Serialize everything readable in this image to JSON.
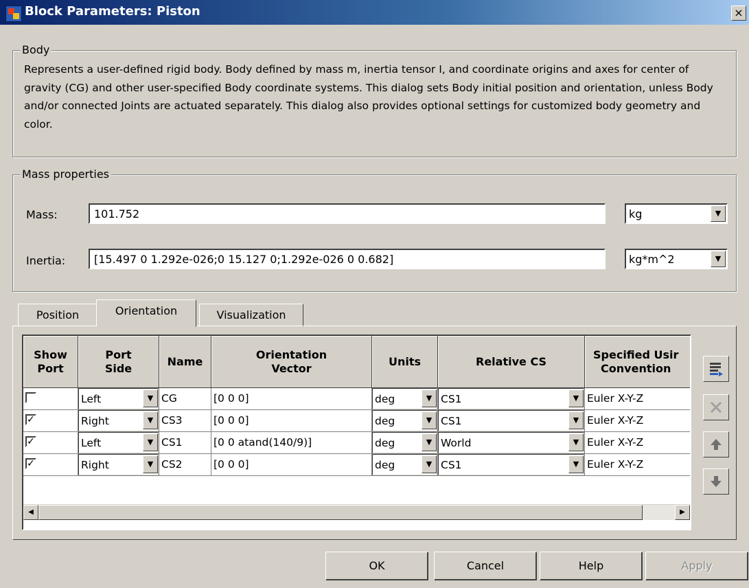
{
  "window": {
    "title": "Block Parameters: Piston",
    "close_label": "×"
  },
  "body_group": {
    "legend": "Body",
    "description": "Represents a user-defined rigid body. Body defined by mass m, inertia tensor I, and coordinate origins and axes for center of gravity (CG) and other user-specified Body coordinate systems. This dialog sets Body initial position and orientation, unless Body and/or connected Joints are actuated separately. This dialog also provides optional settings for customized body geometry and color."
  },
  "mass_group": {
    "legend": "Mass properties",
    "mass_label": "Mass:",
    "mass_value": "101.752",
    "mass_unit": "kg",
    "inertia_label": "Inertia:",
    "inertia_value": "[15.497 0 1.292e-026;0 15.127 0;1.292e-026 0 0.682]",
    "inertia_unit": "kg*m^2"
  },
  "tabs": [
    {
      "label": "Position",
      "active": false
    },
    {
      "label": "Orientation",
      "active": true
    },
    {
      "label": "Visualization",
      "active": false
    }
  ],
  "table": {
    "headers": [
      "Show\nPort",
      "Port\nSide",
      "Name",
      "Orientation\nVector",
      "Units",
      "Relative CS",
      "Specified Usir\nConvention"
    ],
    "rows": [
      {
        "show_port": false,
        "port_side": "Left",
        "name": "CG",
        "vector": "[0 0 0]",
        "units": "deg",
        "relative_cs": "CS1",
        "convention": "Euler X-Y-Z"
      },
      {
        "show_port": true,
        "port_side": "Right",
        "name": "CS3",
        "vector": "[0 0 0]",
        "units": "deg",
        "relative_cs": "CS1",
        "convention": "Euler X-Y-Z"
      },
      {
        "show_port": true,
        "port_side": "Left",
        "name": "CS1",
        "vector": "[0 0 atand(140/9)]",
        "units": "deg",
        "relative_cs": "World",
        "convention": "Euler X-Y-Z"
      },
      {
        "show_port": true,
        "port_side": "Right",
        "name": "CS2",
        "vector": "[0 0 0]",
        "units": "deg",
        "relative_cs": "CS1",
        "convention": "Euler X-Y-Z"
      }
    ]
  },
  "side_buttons": [
    {
      "icon": "add-row-icon",
      "enabled": true
    },
    {
      "icon": "delete-row-icon",
      "enabled": false
    },
    {
      "icon": "move-up-icon",
      "enabled": true
    },
    {
      "icon": "move-down-icon",
      "enabled": true
    }
  ],
  "buttons": {
    "ok": "OK",
    "cancel": "Cancel",
    "help": "Help",
    "apply": "Apply"
  },
  "icons": {
    "dropdown_arrow": "▼",
    "checkmark": "✓",
    "scroll_left": "◀",
    "scroll_right": "▶"
  }
}
